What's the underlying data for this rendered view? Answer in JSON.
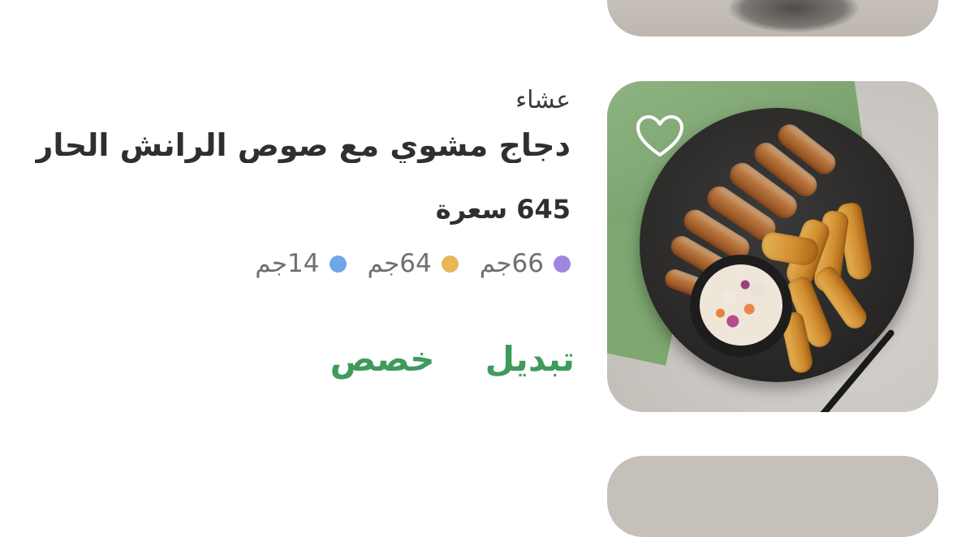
{
  "meal": {
    "type": "عشاء",
    "name": "دجاج مشوي مع صوص الرانش الحار بالعـ...",
    "calories": "645 سعرة",
    "macros": [
      {
        "value": "66جم",
        "color": "#9d86df"
      },
      {
        "value": "64جم",
        "color": "#e9b756"
      },
      {
        "value": "14جم",
        "color": "#6fa6e8"
      }
    ],
    "actions": {
      "replace": "تبديل",
      "customize": "خصص"
    }
  },
  "icons": {
    "favorite": "heart-outline-icon"
  },
  "colors": {
    "accent": "#3f9a5c",
    "text_primary": "#2f2f2f",
    "text_secondary": "#6f6f6f"
  }
}
